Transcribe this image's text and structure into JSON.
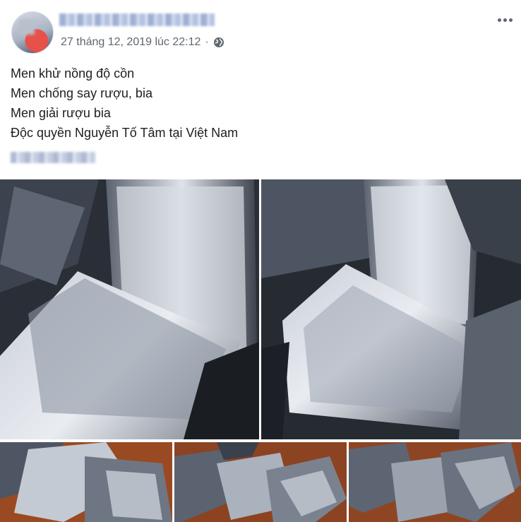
{
  "post": {
    "timestamp": "27 tháng 12, 2019 lúc 22:12",
    "separator": "·",
    "lines": [
      "Men khử nồng độ cồn",
      "Men chống say rượu, bia",
      "Men giải rượu bia",
      "Độc quyền Nguyễn Tố Tâm tại Việt Nam"
    ]
  },
  "icons": {
    "privacy": "globe-icon",
    "options": "more-options-icon"
  },
  "colors": {
    "meta_text": "#606770",
    "body_text": "#1c1e21",
    "foil_light": "#e6eaf0",
    "foil_dark": "#1e2128",
    "table_wood": "#9a4a22"
  }
}
